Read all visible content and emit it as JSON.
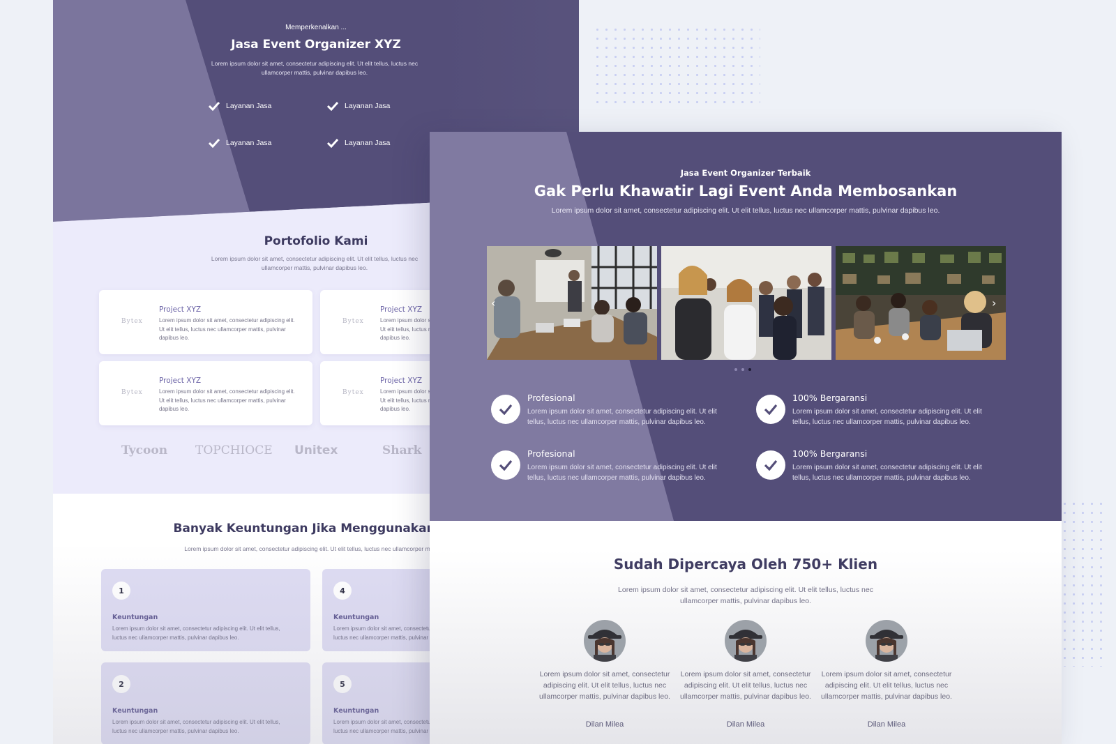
{
  "back_page": {
    "hero": {
      "intro": "Memperkenalkan ...",
      "title": "Jasa Event Organizer XYZ",
      "description": "Lorem ipsum dolor sit amet, consectetur adipiscing elit. Ut elit tellus, luctus nec ullamcorper mattis, pulvinar dapibus leo.",
      "services": [
        "Layanan Jasa",
        "Layanan Jasa",
        "Layanan Jasa",
        "Layanan Jasa"
      ]
    },
    "portfolio": {
      "title": "Portofolio Kami",
      "description": "Lorem ipsum dolor sit amet, consectetur adipiscing elit. Ut elit tellus, luctus nec ullamcorper mattis, pulvinar dapibus leo.",
      "cards": [
        {
          "logo": "Bytex",
          "title": "Project XYZ",
          "text": "Lorem ipsum dolor sit amet, consectetur adipiscing elit. Ut elit tellus, luctus nec ullamcorper mattis, pulvinar dapibus leo."
        },
        {
          "logo": "Bytex",
          "title": "Project XYZ",
          "text": "Lorem ipsum dolor sit amet, consectetur adipiscing elit. Ut elit tellus, luctus nec ullamcorper mattis, pulvinar dapibus leo."
        },
        {
          "logo": "Bytex",
          "title": "Project XYZ",
          "text": "Lorem ipsum dolor sit amet, consectetur adipiscing elit. Ut elit tellus, luctus nec ullamcorper mattis, pulvinar dapibus leo."
        },
        {
          "logo": "Bytex",
          "title": "Project XYZ",
          "text": "Lorem ipsum dolor sit amet, consectetur adipiscing elit. Ut elit tellus, luctus nec ullamcorper mattis, pulvinar dapibus leo."
        }
      ],
      "brands": [
        "Tycoon",
        "TOPCHIOCE",
        "Unitex",
        "Shark"
      ]
    },
    "benefits": {
      "title": "Banyak Keuntungan Jika Menggunakan Jas",
      "description": "Lorem ipsum dolor sit amet, consectetur adipiscing elit. Ut elit tellus, luctus nec ullamcorper mattis, p",
      "cards": [
        {
          "num": "1",
          "title": "Keuntungan",
          "text": "Lorem ipsum dolor sit amet, consectetur adipiscing elit. Ut elit tellus, luctus nec ullamcorper mattis, pulvinar dapibus leo."
        },
        {
          "num": "4",
          "title": "Keuntungan",
          "text": "Lorem ipsum dolor sit amet, consectetur adipiscing elit. Ut elit tellus, luctus nec ullamcorper mattis, pulvinar dapibus leo."
        },
        {
          "num": "2",
          "title": "Keuntungan",
          "text": "Lorem ipsum dolor sit amet, consectetur adipiscing elit. Ut elit tellus, luctus nec ullamcorper mattis, pulvinar dapibus leo."
        },
        {
          "num": "5",
          "title": "Keuntungan",
          "text": "Lorem ipsum dolor sit amet, consectetur adipiscing elit. Ut elit tellus, luctus nec ullamcorper mattis, pulvinar dapibus leo."
        }
      ]
    }
  },
  "front_page": {
    "hero": {
      "intro": "Jasa Event Organizer Terbaik",
      "title": "Gak Perlu Khawatir Lagi Event Anda Membosankan",
      "description": "Lorem ipsum dolor sit amet, consectetur adipiscing elit. Ut elit tellus, luctus nec ullamcorper mattis, pulvinar dapibus leo."
    },
    "slider": {
      "active_index": 2,
      "dot_count": 3,
      "prev_icon": "chevron-left-icon",
      "next_icon": "chevron-right-icon"
    },
    "features": [
      {
        "title": "Profesional",
        "text": "Lorem ipsum dolor sit amet, consectetur adipiscing elit. Ut elit tellus, luctus nec ullamcorper mattis, pulvinar dapibus leo."
      },
      {
        "title": "100% Bergaransi",
        "text": "Lorem ipsum dolor sit amet, consectetur adipiscing elit. Ut elit tellus, luctus nec ullamcorper mattis, pulvinar dapibus leo."
      },
      {
        "title": "Profesional",
        "text": "Lorem ipsum dolor sit amet, consectetur adipiscing elit. Ut elit tellus, luctus nec ullamcorper mattis, pulvinar dapibus leo."
      },
      {
        "title": "100% Bergaransi",
        "text": "Lorem ipsum dolor sit amet, consectetur adipiscing elit. Ut elit tellus, luctus nec ullamcorper mattis, pulvinar dapibus leo."
      }
    ],
    "clients": {
      "title": "Sudah Dipercaya Oleh 750+ Klien",
      "description": "Lorem ipsum dolor sit amet, consectetur adipiscing elit. Ut elit tellus, luctus nec ullamcorper mattis, pulvinar dapibus leo.",
      "testimonials": [
        {
          "quote": "Lorem ipsum dolor sit amet, consectetur adipiscing elit. Ut elit tellus, luctus nec ullamcorper mattis, pulvinar dapibus leo.",
          "name": "Dilan Milea"
        },
        {
          "quote": "Lorem ipsum dolor sit amet, consectetur adipiscing elit. Ut elit tellus, luctus nec ullamcorper mattis, pulvinar dapibus leo.",
          "name": "Dilan Milea"
        },
        {
          "quote": "Lorem ipsum dolor sit amet, consectetur adipiscing elit. Ut elit tellus, luctus nec ullamcorper mattis, pulvinar dapibus leo.",
          "name": "Dilan Milea"
        }
      ]
    }
  },
  "colors": {
    "primary": "#544e79",
    "primary_light": "#807aa1",
    "accent_text": "#3d3a60",
    "soft_bg": "#ecebfb",
    "card_bg": "#dedcf3"
  }
}
